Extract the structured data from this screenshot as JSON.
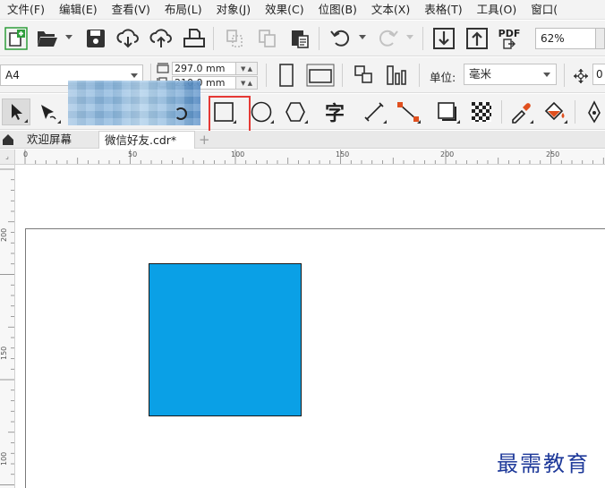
{
  "menu": {
    "items": [
      "文件(F)",
      "编辑(E)",
      "查看(V)",
      "布局(L)",
      "对象(J)",
      "效果(C)",
      "位图(B)",
      "文本(X)",
      "表格(T)",
      "工具(O)",
      "窗口("
    ]
  },
  "toolbar": {
    "zoom_value": "62%",
    "pdf_label": "PDF"
  },
  "property_bar": {
    "page_size": "A4",
    "width_value": "297.0 mm",
    "height_value": "210.0 mm",
    "units_label": "单位:",
    "units_value": "毫米",
    "nudge_value": "0"
  },
  "toolbox": {
    "text_tool_glyph": "字"
  },
  "tabs": [
    {
      "label": "欢迎屏幕",
      "active": false
    },
    {
      "label": "微信好友.cdr*",
      "active": true
    }
  ],
  "tab_add_label": "+",
  "rulers": {
    "horizontal_ticks": [
      "0",
      "50",
      "100",
      "150",
      "200",
      "250"
    ],
    "vertical_ticks": [
      "200",
      "150",
      "100"
    ]
  },
  "canvas": {
    "rectangle_fill": "#0aa0e6",
    "rectangle_stroke": "#1a1a1a"
  },
  "watermark_text": "最需教育",
  "colors": {
    "accent_green": "#2e9e3b",
    "highlight_red": "#e53935",
    "shape_blue": "#0aa0e6"
  }
}
